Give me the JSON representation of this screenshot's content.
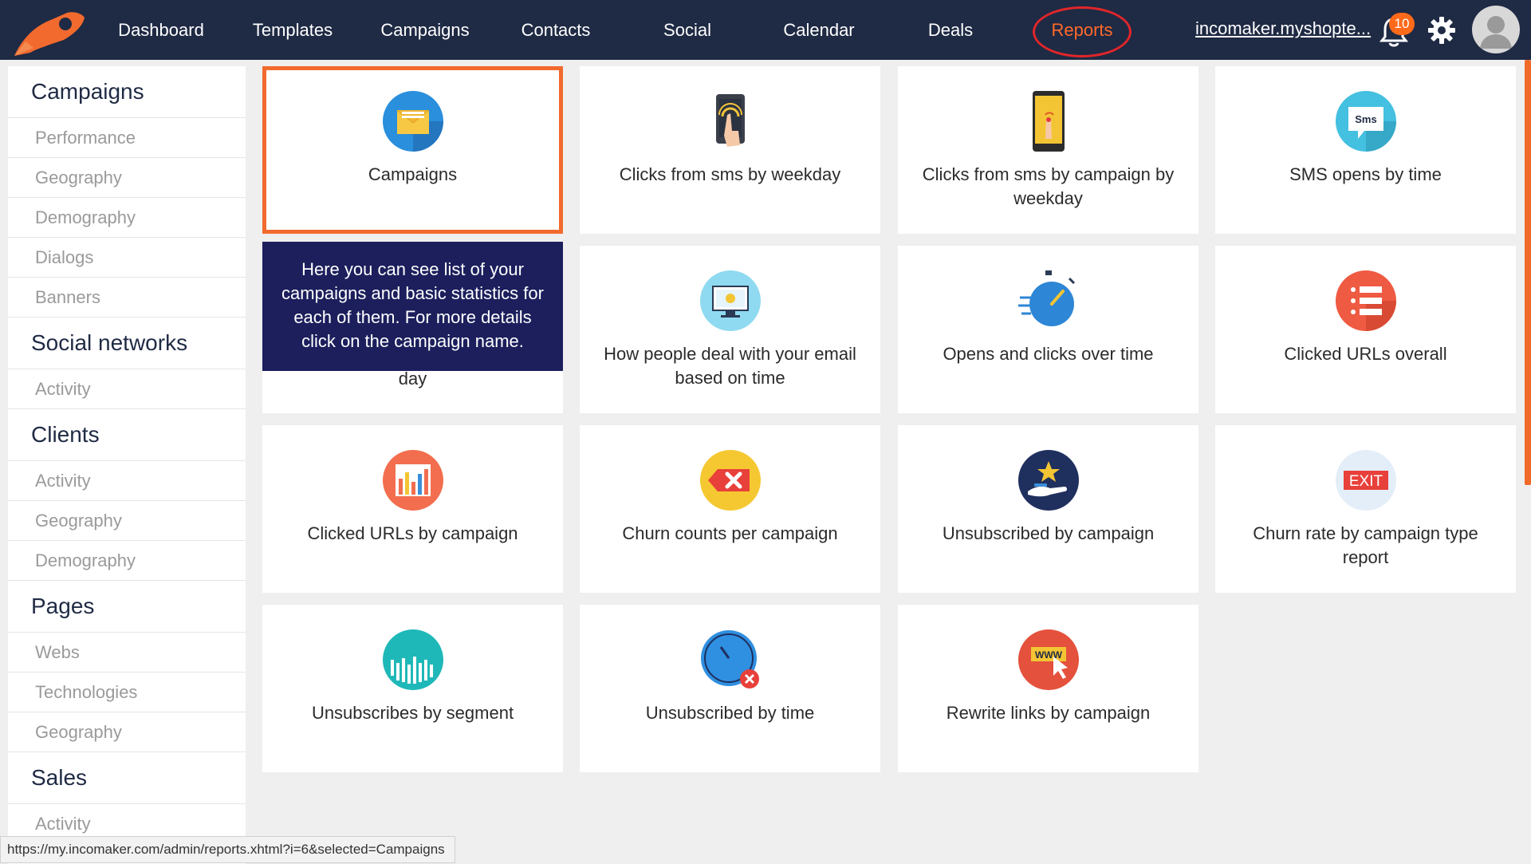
{
  "nav": {
    "items": [
      {
        "label": "Dashboard"
      },
      {
        "label": "Templates"
      },
      {
        "label": "Campaigns"
      },
      {
        "label": "Contacts"
      },
      {
        "label": "Social"
      },
      {
        "label": "Calendar"
      },
      {
        "label": "Deals"
      },
      {
        "label": "Reports"
      }
    ],
    "account": "incomaker.myshopte...",
    "notification_count": "10"
  },
  "sidebar": {
    "groups": [
      {
        "title": "Campaigns",
        "items": [
          "Performance",
          "Geography",
          "Demography",
          "Dialogs",
          "Banners"
        ]
      },
      {
        "title": "Social networks",
        "items": [
          "Activity"
        ]
      },
      {
        "title": "Clients",
        "items": [
          "Activity",
          "Geography",
          "Demography"
        ]
      },
      {
        "title": "Pages",
        "items": [
          "Webs",
          "Technologies",
          "Geography"
        ]
      },
      {
        "title": "Sales",
        "items": [
          "Activity"
        ]
      }
    ]
  },
  "reports": {
    "tiles": [
      {
        "label": "Campaigns",
        "icon": "envelope-icon"
      },
      {
        "label": "Clicks from sms by weekday",
        "icon": "phone-tap-icon"
      },
      {
        "label": "Clicks from sms by campaign by weekday",
        "icon": "phone-finger-icon"
      },
      {
        "label": "SMS opens by time",
        "icon": "sms-bubble-icon"
      },
      {
        "label": "day",
        "icon": ""
      },
      {
        "label": "How people deal with your email based on time",
        "icon": "monitor-icon"
      },
      {
        "label": "Opens and clicks over time",
        "icon": "stopwatch-icon"
      },
      {
        "label": "Clicked URLs overall",
        "icon": "list-icon"
      },
      {
        "label": "Clicked URLs by campaign",
        "icon": "bar-chart-icon"
      },
      {
        "label": "Churn counts per campaign",
        "icon": "delete-tag-icon"
      },
      {
        "label": "Unsubscribed by campaign",
        "icon": "hand-star-icon"
      },
      {
        "label": "Churn rate by campaign type report",
        "icon": "exit-sign-icon"
      },
      {
        "label": "Unsubscribes by segment",
        "icon": "segment-bars-icon"
      },
      {
        "label": "Unsubscribed by time",
        "icon": "clock-x-icon"
      },
      {
        "label": "Rewrite links by campaign",
        "icon": "www-cursor-icon"
      }
    ],
    "tooltip": "Here you can see list of your campaigns and basic statistics for each of them. For more details click on the campaign name."
  },
  "status_url": "https://my.incomaker.com/admin/reports.xhtml?i=6&selected=Campaigns"
}
